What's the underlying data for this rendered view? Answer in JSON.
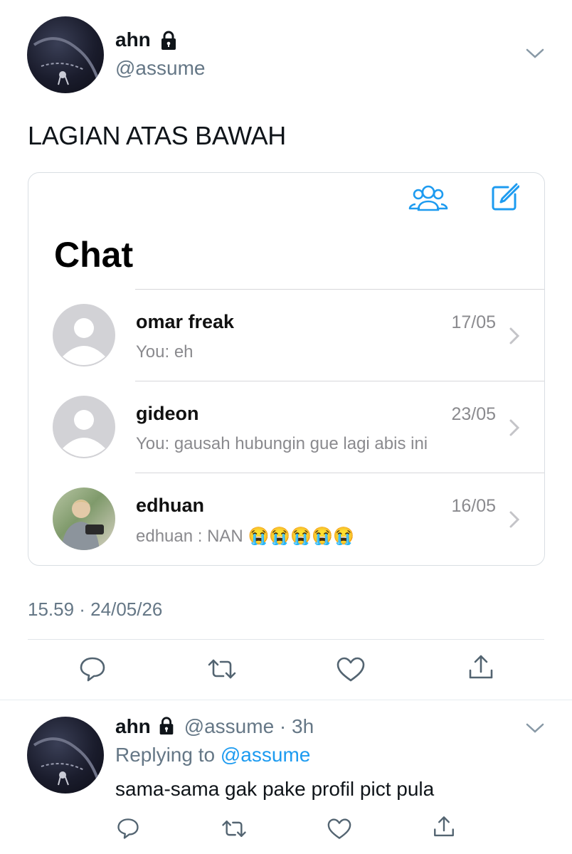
{
  "tweet": {
    "author_name": "ahn",
    "handle": "@assume",
    "text": "LAGIAN ATAS BAWAH",
    "timestamp": "15.59 · 24/05/26"
  },
  "card": {
    "title": "Chat",
    "rows": [
      {
        "name": "omar freak",
        "date": "17/05",
        "preview": "You: eh"
      },
      {
        "name": "gideon",
        "date": "23/05",
        "preview": "You: gausah hubungin gue lagi abis ini"
      },
      {
        "name": "edhuan",
        "date": "16/05",
        "preview": "edhuan : NAN"
      }
    ],
    "emoji": [
      "😭",
      "😭",
      "😭",
      "😭",
      "😭"
    ]
  },
  "reply": {
    "author_name": "ahn",
    "handle_time": "@assume · 3h",
    "replying_prefix": "Replying to",
    "replying_handle": "@assume",
    "text": "sama-sama gak pake profil pict pula"
  },
  "colors": {
    "accent": "#1d9bf0",
    "muted": "#657786"
  },
  "icons": [
    "lock-icon",
    "chevron-down-icon",
    "group-icon",
    "compose-icon",
    "chevron-right-icon",
    "reply-icon",
    "retweet-icon",
    "like-icon",
    "share-icon"
  ]
}
